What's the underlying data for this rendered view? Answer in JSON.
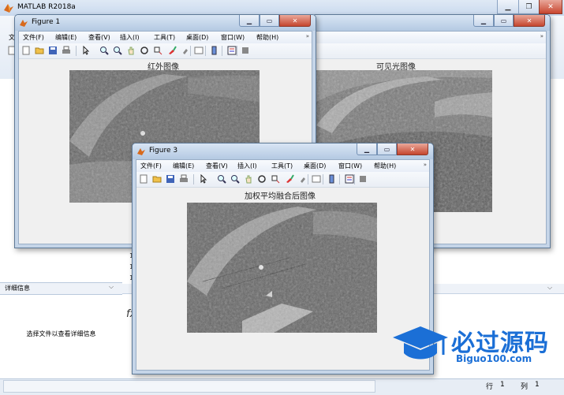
{
  "main_window": {
    "title": "MATLAB R2018a",
    "minimize_icon": "minimize-icon",
    "restore_icon": "restore-icon",
    "close_icon": "close-icon"
  },
  "details_panel": {
    "title": "详细信息",
    "message": "选择文件以查看详细信息"
  },
  "command_area": {
    "fx_symbol": "fx"
  },
  "status_bar": {
    "row_label": "行",
    "row_value": "1",
    "col_label": "列",
    "col_value": "1"
  },
  "figure_menu": [
    "文件(F)",
    "编辑(E)",
    "查看(V)",
    "插入(I)",
    "工具(T)",
    "桌面(D)",
    "窗口(W)",
    "帮助(H)"
  ],
  "figure_toolbar_icons": [
    "new-figure-icon",
    "open-file-icon",
    "save-icon",
    "print-icon",
    "edit-plot-icon",
    "zoom-in-icon",
    "zoom-out-icon",
    "pan-icon",
    "rotate-3d-icon",
    "data-cursor-icon",
    "brush-icon",
    "link-plot-icon",
    "colorbar-icon",
    "legend-icon",
    "hide-plot-tools-icon",
    "show-plot-tools-icon"
  ],
  "figures": [
    {
      "title": "Figure 1",
      "axes_title": "红外图像"
    },
    {
      "title": "",
      "axes_title": "可见光图像"
    },
    {
      "title": "Figure 3",
      "axes_title": "加权平均融合后图像"
    }
  ],
  "watermark": {
    "text": "必过源码",
    "url": "Biguo100.com"
  },
  "colors": {
    "title_blue": "#c5d5e8",
    "close_red": "#c5452e",
    "watermark_blue": "#1b6fd6"
  }
}
